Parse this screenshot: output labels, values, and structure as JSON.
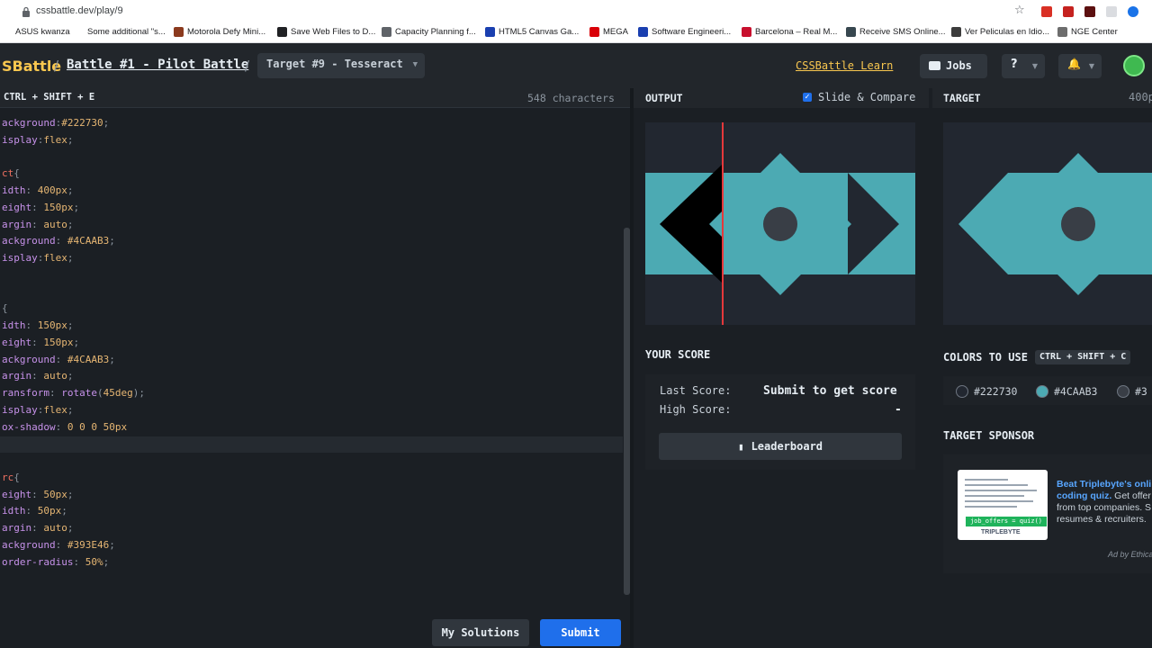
{
  "browser": {
    "url": "cssbattle.dev/play/9",
    "bookmarks": [
      {
        "label": "ASUS kwanza",
        "color": "#ffffff"
      },
      {
        "label": "Some additional \"s...",
        "color": "#ffffff"
      },
      {
        "label": "Motorola Defy Mini...",
        "color": "#8b3a1e"
      },
      {
        "label": "Save Web Files to D...",
        "color": "#202124"
      },
      {
        "label": "Capacity Planning f...",
        "color": "#5f6368"
      },
      {
        "label": "HTML5 Canvas Ga...",
        "color": "#1a3fb0"
      },
      {
        "label": "MEGA",
        "color": "#d90007"
      },
      {
        "label": "Software Engineeri...",
        "color": "#1a3fb0"
      },
      {
        "label": "Barcelona – Real M...",
        "color": "#c8102e"
      },
      {
        "label": "Receive SMS Online...",
        "color": "#37474f"
      },
      {
        "label": "Ver Peliculas en Idio...",
        "color": "#3c3c3c"
      },
      {
        "label": "NGE Center",
        "color": "#6d6d6d"
      }
    ]
  },
  "header": {
    "logo": "SBattle",
    "separator": "/",
    "battle": "Battle #1 - Pilot Battle",
    "target": "Target #9 - Tesseract",
    "learn": "CSSBattle Learn",
    "jobs": "Jobs",
    "help": "?",
    "bell": "🔔"
  },
  "editor": {
    "shortcut": "CTRL + SHIFT + E",
    "char_count": "548 characters",
    "lines": [
      [
        [
          "ackground",
          "prop"
        ],
        [
          ":",
          "punc"
        ],
        [
          "#222730",
          "val"
        ],
        [
          ";",
          "punc"
        ]
      ],
      [
        [
          "isplay",
          "prop"
        ],
        [
          ":",
          "punc"
        ],
        [
          "flex",
          "val"
        ],
        [
          ";",
          "punc"
        ]
      ],
      [],
      [
        [
          "ct",
          "sel"
        ],
        [
          "{",
          "punc"
        ]
      ],
      [
        [
          "idth",
          "prop"
        ],
        [
          ": ",
          "punc"
        ],
        [
          "400px",
          "num"
        ],
        [
          ";",
          "punc"
        ]
      ],
      [
        [
          "eight",
          "prop"
        ],
        [
          ": ",
          "punc"
        ],
        [
          "150px",
          "num"
        ],
        [
          ";",
          "punc"
        ]
      ],
      [
        [
          "argin",
          "prop"
        ],
        [
          ": ",
          "punc"
        ],
        [
          "auto",
          "val"
        ],
        [
          ";",
          "punc"
        ]
      ],
      [
        [
          "ackground",
          "prop"
        ],
        [
          ": ",
          "punc"
        ],
        [
          "#4CAAB3",
          "val"
        ],
        [
          ";",
          "punc"
        ]
      ],
      [
        [
          "isplay",
          "prop"
        ],
        [
          ":",
          "punc"
        ],
        [
          "flex",
          "val"
        ],
        [
          ";",
          "punc"
        ]
      ],
      [],
      [],
      [
        [
          "",
          "sel"
        ],
        [
          "{",
          "punc"
        ]
      ],
      [
        [
          "idth",
          "prop"
        ],
        [
          ": ",
          "punc"
        ],
        [
          "150px",
          "num"
        ],
        [
          ";",
          "punc"
        ]
      ],
      [
        [
          "eight",
          "prop"
        ],
        [
          ": ",
          "punc"
        ],
        [
          "150px",
          "num"
        ],
        [
          ";",
          "punc"
        ]
      ],
      [
        [
          "ackground",
          "prop"
        ],
        [
          ": ",
          "punc"
        ],
        [
          "#4CAAB3",
          "val"
        ],
        [
          ";",
          "punc"
        ]
      ],
      [
        [
          "argin",
          "prop"
        ],
        [
          ": ",
          "punc"
        ],
        [
          "auto",
          "val"
        ],
        [
          ";",
          "punc"
        ]
      ],
      [
        [
          "ransform",
          "prop"
        ],
        [
          ": ",
          "punc"
        ],
        [
          "rotate",
          "fn"
        ],
        [
          "(",
          "punc"
        ],
        [
          "45deg",
          "num"
        ],
        [
          ")",
          "punc"
        ],
        [
          ";",
          "punc"
        ]
      ],
      [
        [
          "isplay",
          "prop"
        ],
        [
          ":",
          "punc"
        ],
        [
          "flex",
          "val"
        ],
        [
          ";",
          "punc"
        ]
      ],
      [
        [
          "ox-shadow",
          "prop"
        ],
        [
          ": ",
          "punc"
        ],
        [
          "0 0 0 50px",
          "num"
        ]
      ],
      [],
      [],
      [
        [
          "rc",
          "sel"
        ],
        [
          "{",
          "punc"
        ]
      ],
      [
        [
          "eight",
          "prop"
        ],
        [
          ": ",
          "punc"
        ],
        [
          "50px",
          "num"
        ],
        [
          ";",
          "punc"
        ]
      ],
      [
        [
          "idth",
          "prop"
        ],
        [
          ": ",
          "punc"
        ],
        [
          "50px",
          "num"
        ],
        [
          ";",
          "punc"
        ]
      ],
      [
        [
          "argin",
          "prop"
        ],
        [
          ": ",
          "punc"
        ],
        [
          "auto",
          "val"
        ],
        [
          ";",
          "punc"
        ]
      ],
      [
        [
          "ackground",
          "prop"
        ],
        [
          ": ",
          "punc"
        ],
        [
          "#393E46",
          "val"
        ],
        [
          ";",
          "punc"
        ]
      ],
      [
        [
          "order-radius",
          "prop"
        ],
        [
          ": ",
          "punc"
        ],
        [
          "50%",
          "num"
        ],
        [
          ";",
          "punc"
        ]
      ]
    ],
    "my_solutions": "My Solutions",
    "submit": "Submit"
  },
  "output": {
    "title": "OUTPUT",
    "slide_compare": "Slide & Compare",
    "slide_compare_checked": true
  },
  "target": {
    "title": "TARGET",
    "size": "400p"
  },
  "score": {
    "title": "YOUR SCORE",
    "last_label": "Last Score:",
    "last_value": "Submit to get score",
    "high_label": "High Score:",
    "high_value": "-",
    "leaderboard": "Leaderboard"
  },
  "colors": {
    "title": "COLORS TO USE",
    "shortcut": "CTRL + SHIFT + C",
    "items": [
      {
        "label": "#222730",
        "hex": "#222730"
      },
      {
        "label": "#4CAAB3",
        "hex": "#4CAAB3"
      },
      {
        "label": "#3",
        "hex": "#393E46"
      }
    ]
  },
  "sponsor": {
    "title": "TARGET SPONSOR",
    "tag": "job_offers = quiz()",
    "brand": "TRIPLEBYTE",
    "headline": "Beat Triplebyte's onli",
    "headline2": "coding quiz.",
    "body": [
      " Get offer",
      "from top companies. S",
      "resumes & recruiters."
    ],
    "ad_by": "Ad by Ethica"
  },
  "palette": {
    "bg": "#222730",
    "teal": "#4CAAB3",
    "circle": "#393E46",
    "accent": "#f9c74f",
    "submit": "#1f6feb",
    "slider": "#e5383b"
  }
}
